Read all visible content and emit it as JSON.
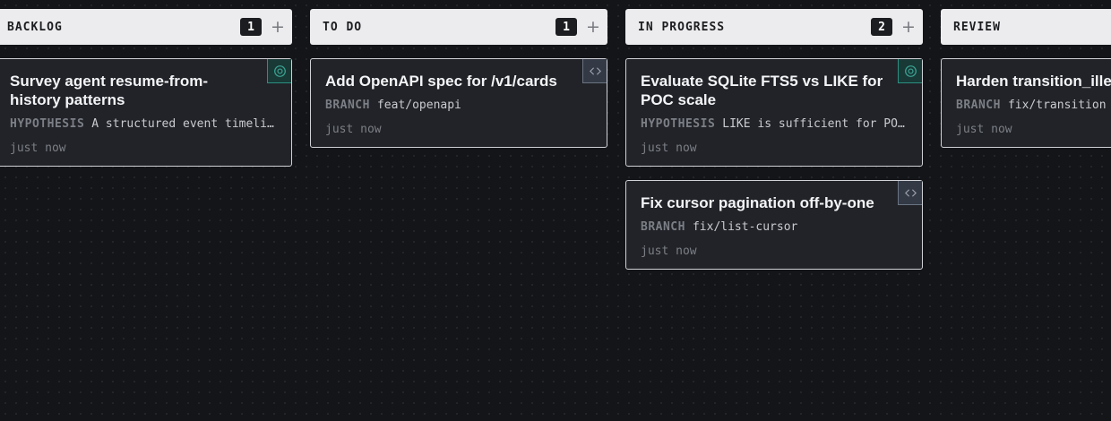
{
  "columns": [
    {
      "title": "BACKLOG",
      "count": "1",
      "add_label": "+",
      "cards": [
        {
          "title": "Survey agent resume-from-history patterns",
          "meta_key": "HYPOTHESIS",
          "meta_value": "A structured event timeline",
          "time": "just now",
          "badge_icon": "target-icon"
        }
      ]
    },
    {
      "title": "TO DO",
      "count": "1",
      "add_label": "+",
      "cards": [
        {
          "title": "Add OpenAPI spec for /v1/cards",
          "meta_key": "BRANCH",
          "meta_value": "feat/openapi",
          "time": "just now",
          "badge_icon": "code-icon"
        }
      ]
    },
    {
      "title": "IN PROGRESS",
      "count": "2",
      "add_label": "+",
      "cards": [
        {
          "title": "Evaluate SQLite FTS5 vs LIKE for POC scale",
          "meta_key": "HYPOTHESIS",
          "meta_value": "LIKE is sufficient for POC scale",
          "time": "just now",
          "badge_icon": "target-icon"
        },
        {
          "title": "Fix cursor pagination off-by-one",
          "meta_key": "BRANCH",
          "meta_value": "fix/list-cursor",
          "time": "just now",
          "badge_icon": "code-icon"
        }
      ]
    },
    {
      "title": "REVIEW",
      "count": "",
      "add_label": "",
      "cards": [
        {
          "title": "Harden transition_illegal",
          "meta_key": "BRANCH",
          "meta_value": "fix/transition",
          "time": "just now",
          "badge_icon": ""
        }
      ]
    }
  ],
  "colors": {
    "background": "#141518",
    "header_bg": "#ececee",
    "card_bg": "#212328",
    "card_border": "#cfd1d6",
    "hypothesis_accent": "#2b8f80",
    "branch_accent": "#6b7381"
  }
}
